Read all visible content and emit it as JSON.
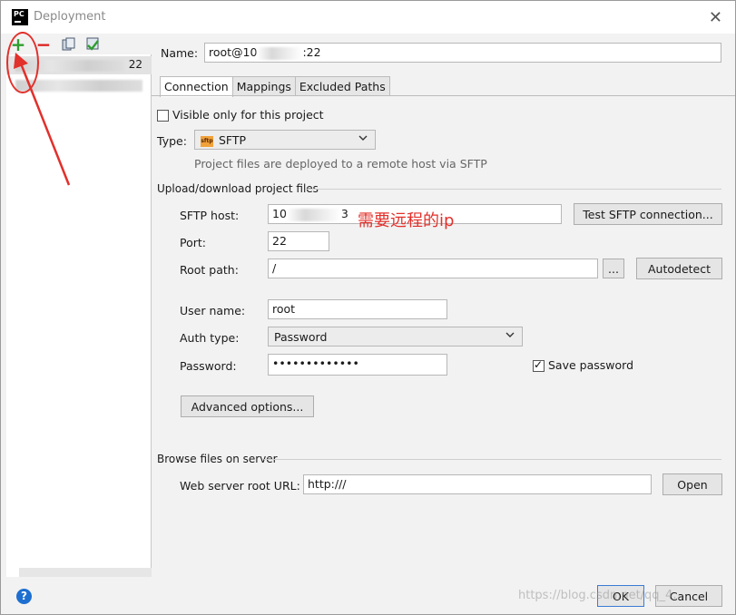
{
  "window": {
    "title": "Deployment",
    "app_badge": "PC",
    "close_glyph": "✕"
  },
  "left": {
    "add_glyph": "+",
    "remove_glyph": "−",
    "server_suffix": "22"
  },
  "name": {
    "label": "Name:",
    "prefix": "root@10",
    "suffix": ":22"
  },
  "tabs": [
    "Connection",
    "Mappings",
    "Excluded Paths"
  ],
  "connection": {
    "visible_only_label": "Visible only for this project",
    "type_label": "Type:",
    "type_value": "SFTP",
    "type_icon_text": "sftp",
    "type_hint": "Project files are deployed to a remote host via SFTP",
    "upload_section": "Upload/download project files",
    "sftp_host_label": "SFTP host:",
    "sftp_host_prefix": "10",
    "sftp_host_suffix": "3",
    "annotation": "需要远程的ip",
    "test_button": "Test SFTP connection...",
    "port_label": "Port:",
    "port_value": "22",
    "root_path_label": "Root path:",
    "root_path_value": "/",
    "browse_button": "...",
    "autodetect_button": "Autodetect",
    "user_label": "User name:",
    "user_value": "root",
    "auth_label": "Auth type:",
    "auth_value": "Password",
    "password_label": "Password:",
    "password_value": "•••••••••••••",
    "save_password_label": "Save password",
    "advanced_button": "Advanced options...",
    "browse_section": "Browse files on server",
    "web_root_label": "Web server root URL:",
    "web_root_value": "http:///",
    "open_button": "Open"
  },
  "footer": {
    "help_glyph": "?",
    "ok_button": "OK",
    "cancel_button": "Cancel",
    "watermark": "https://blog.csdn.net/qq_4..."
  },
  "colors": {
    "annotation": "#e2302b",
    "add_icon": "#2f9e2f",
    "remove_icon": "#dd2222"
  }
}
